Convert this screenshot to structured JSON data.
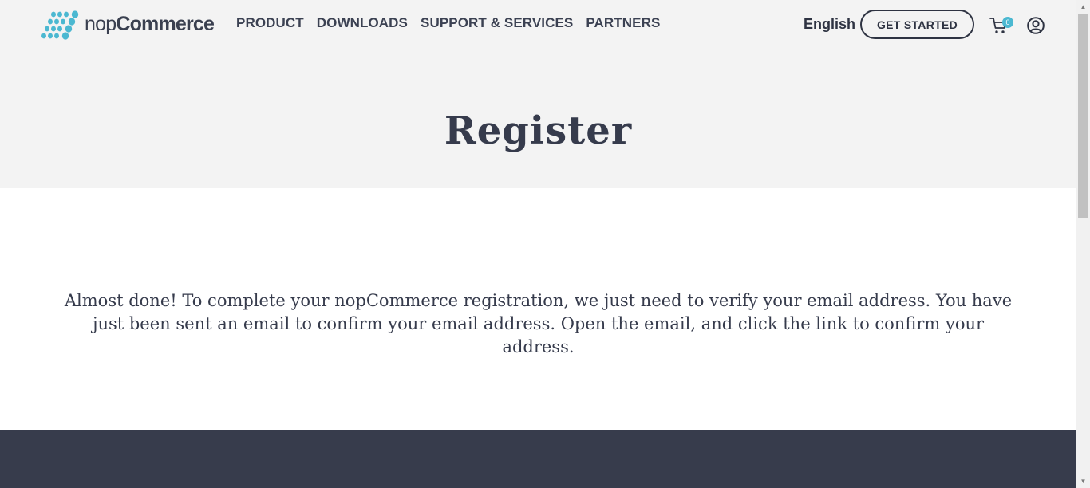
{
  "brand": {
    "name_light": "nop",
    "name_bold": "Commerce",
    "accent_color": "#4bb8d1"
  },
  "nav": {
    "items": [
      {
        "label": "PRODUCT"
      },
      {
        "label": "DOWNLOADS"
      },
      {
        "label": "SUPPORT & SERVICES"
      },
      {
        "label": "PARTNERS"
      }
    ]
  },
  "header": {
    "language": "English",
    "cta_label": "GET STARTED",
    "cart_count": "0"
  },
  "page": {
    "title": "Register",
    "message": "Almost done! To complete your nopCommerce registration, we just need to verify your email address. You have just been sent an email to confirm your email address. Open the email, and click the link to confirm your address."
  },
  "colors": {
    "header_bg": "#f3f3f3",
    "footer_bg": "#373c4c",
    "text_dark": "#363b4c"
  },
  "icons": [
    "nopcommerce-logo-icon",
    "cart-icon",
    "account-icon",
    "scroll-up-arrow-icon",
    "scroll-down-arrow-icon"
  ]
}
